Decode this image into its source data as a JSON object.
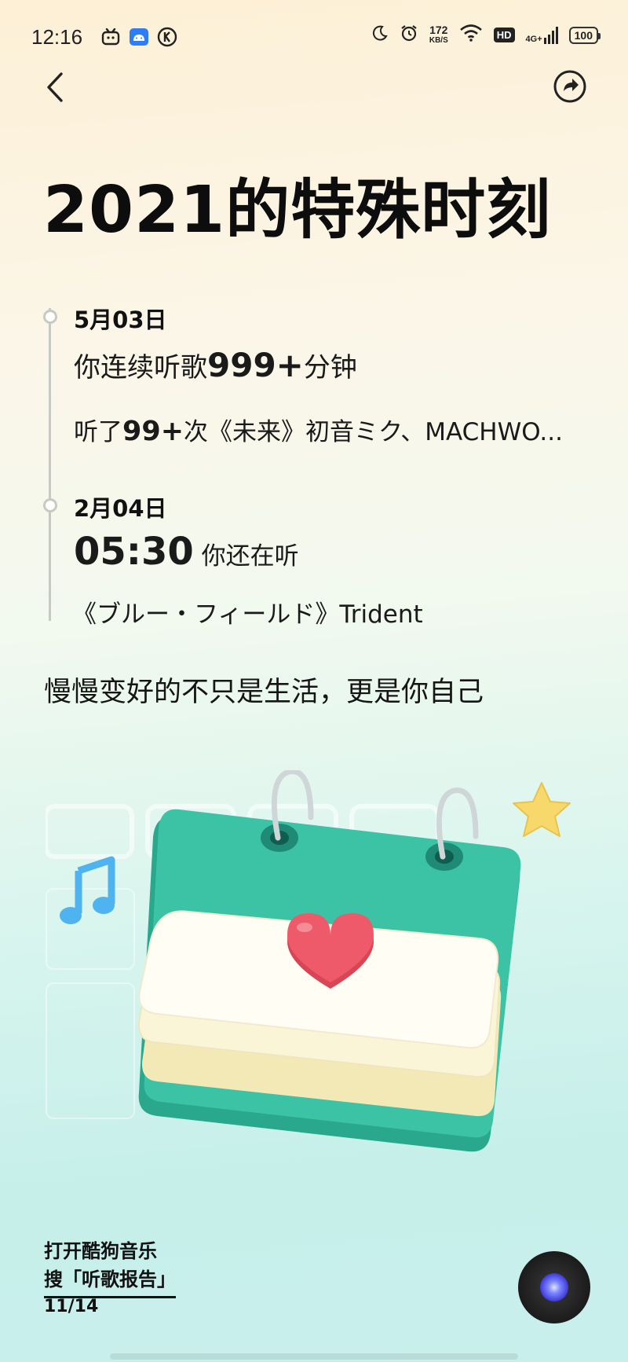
{
  "status_bar": {
    "time": "12:16",
    "speed_value": "172",
    "speed_unit": "KB/S",
    "hd": "HD",
    "network": "4G+",
    "battery": "100"
  },
  "nav": {
    "back_icon": "chevron-left-icon",
    "share_icon": "share-icon"
  },
  "title": "2021的特殊时刻",
  "moments": [
    {
      "date": "5月03日",
      "line1_prefix": "你连续听歌",
      "line1_big": "999+",
      "line1_suffix": "分钟",
      "line2_prefix": "听了",
      "line2_big": "99+",
      "line2_suffix": "次《未来》初音ミク、MACHWO..."
    },
    {
      "date": "2月04日",
      "time_big": "05:30",
      "time_suffix": "你还在听",
      "song": "《ブルー・フィールド》Trident"
    }
  ],
  "tagline": "慢慢变好的不只是生活，更是你自己",
  "footer": {
    "line1": "打开酷狗音乐",
    "line2": "搜「听歌报告」",
    "page": "11/14"
  },
  "illustration": {
    "calendar_color": "#3cc3a6",
    "heart_color": "#ef5a6a",
    "star_color": "#f7d86a",
    "note_color": "#4fb3f0"
  }
}
